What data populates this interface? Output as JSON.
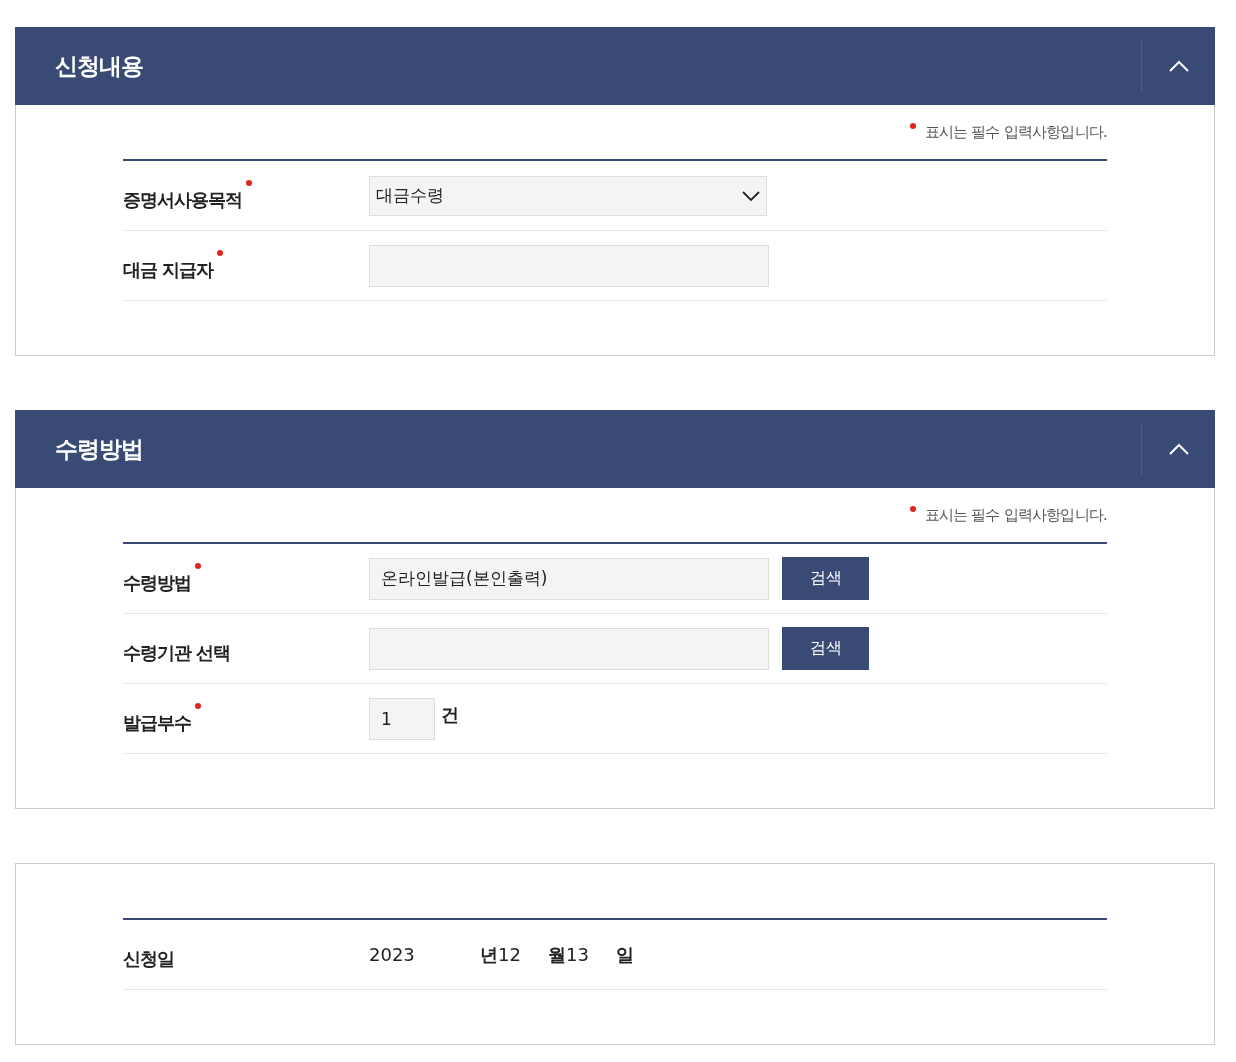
{
  "sections": [
    {
      "title": "신청내용",
      "expanded": true,
      "note": "표시는 필수 입력사항입니다.",
      "rows": [
        {
          "kind": "select",
          "label": "증명서사용목적",
          "required": true,
          "value": "대금수령"
        },
        {
          "kind": "text",
          "label": "대금 지급자",
          "required": true,
          "value": ""
        }
      ]
    },
    {
      "title": "수령방법",
      "expanded": true,
      "note": "표시는 필수 입력사항입니다.",
      "rows": [
        {
          "kind": "text_button",
          "label": "수령방법",
          "required": true,
          "value": "온라인발급(본인출력)",
          "button": "검색"
        },
        {
          "kind": "text_button",
          "label": "수령기관 선택",
          "required": false,
          "value": "",
          "button": "검색"
        },
        {
          "kind": "count",
          "label": "발급부수",
          "required": true,
          "value": "1",
          "unit": "건"
        }
      ]
    },
    {
      "rows": [
        {
          "kind": "date",
          "label": "신청일",
          "required": false,
          "parts": [
            {
              "value": "2023",
              "unit": "년"
            },
            {
              "value": "12",
              "unit": "월"
            },
            {
              "value": "13",
              "unit": "일"
            }
          ]
        }
      ]
    }
  ]
}
